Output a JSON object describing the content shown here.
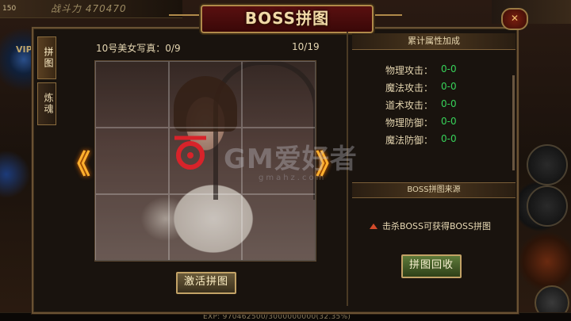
{
  "hud": {
    "level": "150",
    "power": "战斗力 470470",
    "vip": "VIP",
    "exp": "EXP: 970462500/3000000000(32.35%)"
  },
  "window": {
    "title": "BOSS拼图",
    "close_icon": "close-icon"
  },
  "tabs": [
    {
      "label": "拼图",
      "active": true
    },
    {
      "label": "炼魂",
      "active": false
    }
  ],
  "puzzle": {
    "header": "10号美女写真：0/9",
    "count": "10/19",
    "activate_label": "激活拼图",
    "prev_arrow": "《",
    "next_arrow": "》"
  },
  "attributes": {
    "header": "累计属性加成",
    "items": [
      {
        "label": "物理攻击：",
        "value": "0-0"
      },
      {
        "label": "魔法攻击：",
        "value": "0-0"
      },
      {
        "label": "道术攻击：",
        "value": "0-0"
      },
      {
        "label": "物理防御：",
        "value": "0-0"
      },
      {
        "label": "魔法防御：",
        "value": "0-0"
      }
    ]
  },
  "source": {
    "header": "BOSS拼图来源",
    "line": "击杀BOSS可获得BOSS拼图",
    "recycle_label": "拼图回收"
  },
  "watermark": {
    "text": "GM爱好者",
    "sub": "gmahz.com"
  },
  "colors": {
    "value_green": "#37d35a",
    "arrow_orange": "#ffb02e",
    "title_red": "#5a1010"
  }
}
